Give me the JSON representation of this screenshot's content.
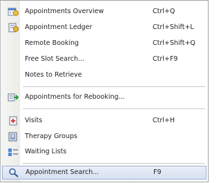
{
  "menu": {
    "group1": [
      {
        "label": "Appointments Overview",
        "shortcut": "Ctrl+Q",
        "icon": "calendar-icon"
      },
      {
        "label": "Appointment Ledger",
        "shortcut": "Ctrl+Shift+L",
        "icon": "ledger-icon"
      },
      {
        "label": "Remote Booking",
        "shortcut": "Ctrl+Shift+Q",
        "icon": ""
      },
      {
        "label": "Free Slot Search...",
        "shortcut": "Ctrl+F9",
        "icon": ""
      },
      {
        "label": "Notes to Retrieve",
        "shortcut": "",
        "icon": ""
      }
    ],
    "group2": [
      {
        "label": "Appointments for Rebooking...",
        "shortcut": "",
        "icon": "rebook-icon"
      }
    ],
    "group3": [
      {
        "label": "Visits",
        "shortcut": "Ctrl+H",
        "icon": "visit-icon"
      },
      {
        "label": "Therapy Groups",
        "shortcut": "",
        "icon": "therapy-groups-icon"
      },
      {
        "label": "Waiting Lists",
        "shortcut": "",
        "icon": "waiting-list-icon"
      }
    ],
    "group4": [
      {
        "label": "Appointment Search...",
        "shortcut": "F9",
        "icon": "search-icon",
        "highlighted": true
      }
    ]
  }
}
